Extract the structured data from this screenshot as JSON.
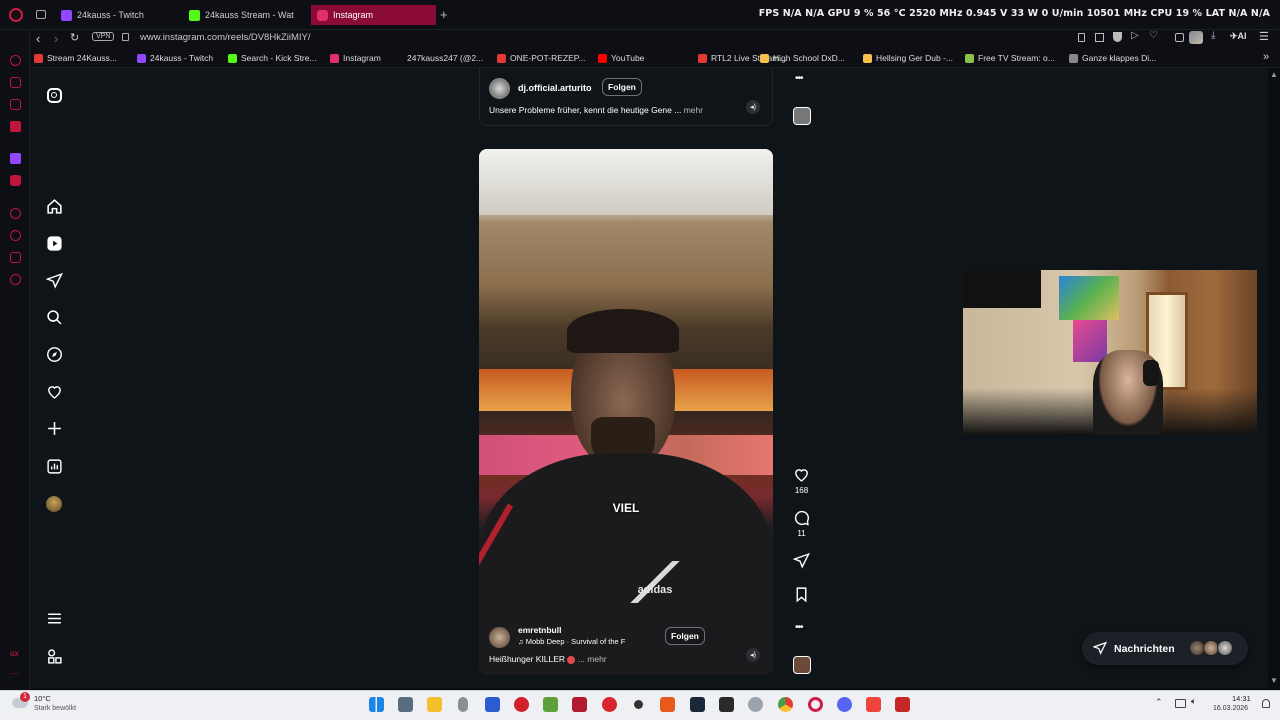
{
  "tabs": [
    {
      "label": "24kauss - Twitch",
      "color": "#9146ff"
    },
    {
      "label": "24kauss Stream - Wat",
      "color": "#53fc18"
    },
    {
      "label": "Instagram",
      "color": "#e1306c",
      "active": true
    }
  ],
  "new_tab": "+",
  "stats": "FPS N/A N/A   GPU 9 % 56 °C 2520 MHz 0.945 V 33 W 0 U/min 10501 MHz   CPU 19 %   LAT N/A N/A",
  "address": {
    "vpn": "VPN",
    "url": "www.instagram.com/reels/DV8HkZiiMIY/"
  },
  "address_right": {
    "ai": "AI"
  },
  "bookmarks": [
    {
      "label": "Stream 24Kauss...",
      "color": "#e53935"
    },
    {
      "label": "24kauss - Twitch",
      "color": "#9146ff"
    },
    {
      "label": "Search - Kick Stre...",
      "color": "#53fc18"
    },
    {
      "label": "Instagram",
      "color": "#e1306c"
    },
    {
      "label": "247kauss247 (@2...",
      "color": "#111111"
    },
    {
      "label": "ONE-POT-REZEP...",
      "color": "#e53935"
    },
    {
      "label": "YouTube",
      "color": "#ff0000"
    },
    {
      "label": "RTL2 Live Stream...",
      "color": "#e53935"
    },
    {
      "label": "High School DxD...",
      "color": "#f6c04a"
    },
    {
      "label": "Hellsing Ger Dub -...",
      "color": "#f6c04a"
    },
    {
      "label": "Free TV Stream: o...",
      "color": "#8bc34a"
    },
    {
      "label": "Ganze klappes Di...",
      "color": "#888888"
    }
  ],
  "reel_prev": {
    "username": "dj.official.arturito",
    "follow": "Folgen",
    "caption": "Unsere Probleme früher, kennt die heutige Gene ...",
    "more": "mehr"
  },
  "reel": {
    "overlay_text": "VIEL",
    "username": "emretnbull",
    "music": "Mobb Deep · Survival of the F",
    "follow": "Folgen",
    "caption": "Heißhunger KILLER",
    "more": "... mehr",
    "likes": "168",
    "comments": "11"
  },
  "messages_button": "Nachrichten",
  "taskbar": {
    "weather_temp": "10°C",
    "weather_desc": "Stark bewölkt",
    "notification": "1",
    "time": "14:31",
    "date": "16.03.2026"
  },
  "colors": {
    "accent": "#8a0b35",
    "opera_red": "#c0163e"
  }
}
